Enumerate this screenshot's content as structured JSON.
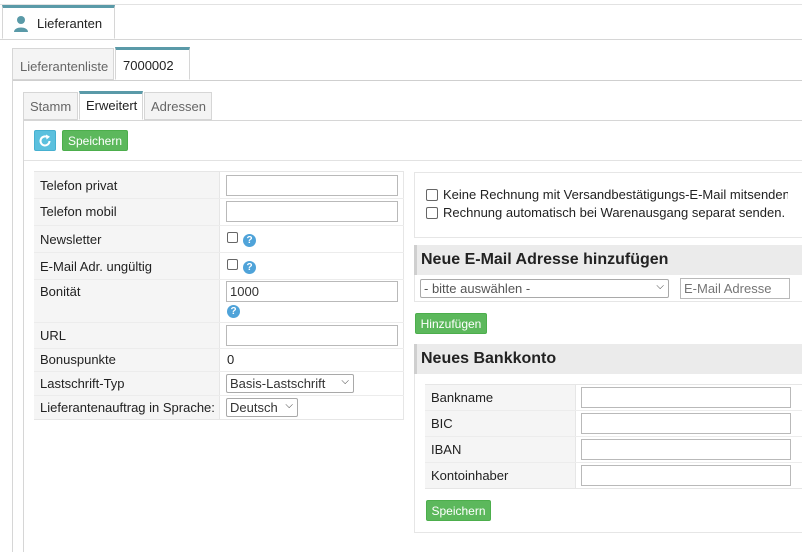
{
  "module_tab": {
    "label": "Lieferanten",
    "icon": "user-icon"
  },
  "tabs_level2": [
    {
      "label": "Lieferantenliste"
    },
    {
      "label": "7000002"
    }
  ],
  "tabs_level3": [
    {
      "label": "Stamm"
    },
    {
      "label": "Erweitert"
    },
    {
      "label": "Adressen"
    }
  ],
  "toolbar": {
    "refresh_icon": "refresh-icon",
    "save_label": "Speichern"
  },
  "form": {
    "telefon_privat": {
      "label": "Telefon privat",
      "value": ""
    },
    "telefon_mobil": {
      "label": "Telefon mobil",
      "value": ""
    },
    "newsletter": {
      "label": "Newsletter",
      "checked": false
    },
    "email_ungueltig": {
      "label": "E-Mail Adr. ungültig",
      "checked": false
    },
    "bonitaet": {
      "label": "Bonität",
      "value": "1000"
    },
    "url": {
      "label": "URL",
      "value": ""
    },
    "bonuspunkte": {
      "label": "Bonuspunkte",
      "value": "0"
    },
    "lastschrift_typ": {
      "label": "Lastschrift-Typ",
      "selected": "Basis-Lastschrift"
    },
    "sprache": {
      "label": "Lieferantenauftrag in Sprache:",
      "selected": "Deutsch"
    }
  },
  "options": {
    "keine_rechnung": {
      "label": "Keine Rechnung mit Versandbestätigungs-E-Mail mitsenden",
      "checked": false
    },
    "rechnung_separat": {
      "label": "Rechnung automatisch bei Warenausgang separat senden.",
      "checked": false
    }
  },
  "email_section": {
    "title": "Neue E-Mail Adresse hinzufügen",
    "select_placeholder": "- bitte auswählen -",
    "email_placeholder": "E-Mail Adresse",
    "add_label": "Hinzufügen"
  },
  "bank_section": {
    "title": "Neues Bankkonto",
    "fields": [
      {
        "label": "Bankname"
      },
      {
        "label": "BIC"
      },
      {
        "label": "IBAN"
      },
      {
        "label": "Kontoinhaber"
      }
    ],
    "save_label": "Speichern"
  },
  "colors": {
    "accent": "#5a9aa8",
    "green": "#5cb85c",
    "info": "#5bc0de",
    "help": "#4fa3d9"
  }
}
